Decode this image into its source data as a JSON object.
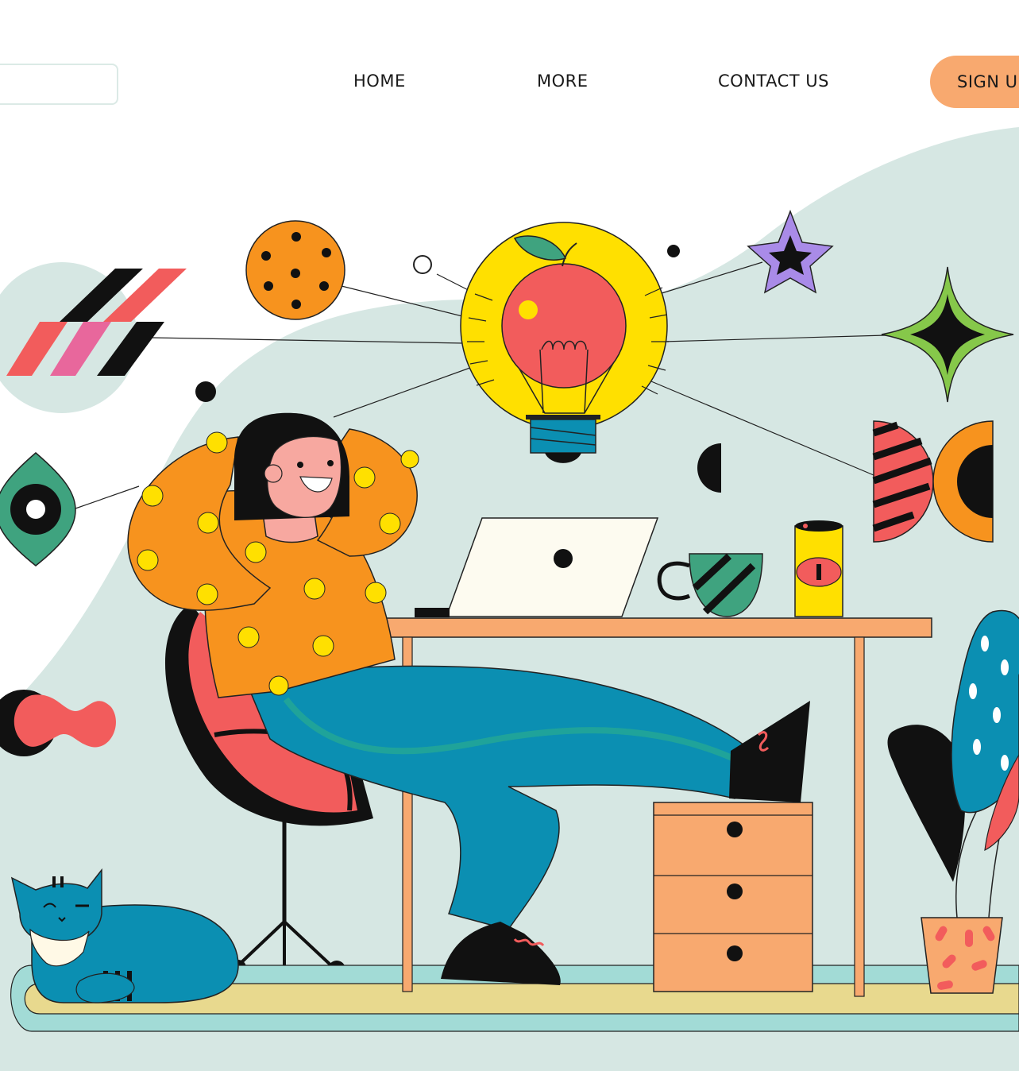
{
  "nav": {
    "links": [
      "HOME",
      "MORE",
      "CONTACT US"
    ],
    "signup_label": "SIGN UP"
  },
  "colors": {
    "background_blob": "#d6e7e3",
    "accent_orange": "#f8a96f",
    "bulb_yellow": "#ffe000",
    "apple_red": "#f25c5c",
    "pants_blue": "#0b8fb2",
    "sweater_orange": "#f7931e"
  },
  "icons": [
    "logo-box",
    "lightbulb-apple-icon",
    "cookie-icon",
    "star-icon",
    "sparkle-icon",
    "eye-icon",
    "laptop-icon",
    "mug-icon",
    "can-icon",
    "cat-icon",
    "plant-icon"
  ]
}
